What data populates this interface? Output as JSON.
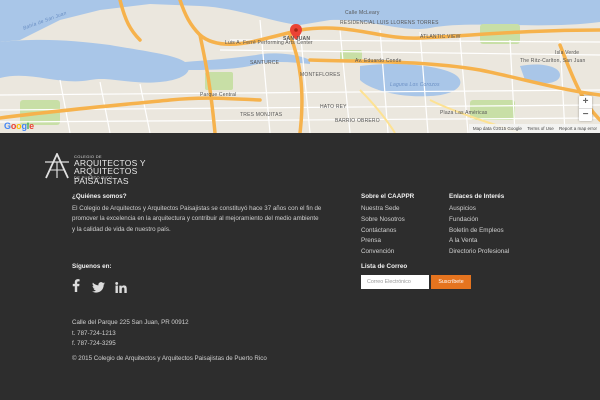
{
  "map": {
    "google_logo": [
      "G",
      "o",
      "o",
      "g",
      "l",
      "e"
    ],
    "google_colors": [
      "#4285f4",
      "#ea4335",
      "#fbbc05",
      "#4285f4",
      "#34a853",
      "#ea4335"
    ],
    "attribution": {
      "data": "Map data ©2015 Google",
      "terms": "Terms of Use",
      "report": "Report a map error"
    },
    "labels": [
      {
        "text": "Bahía de San Juan",
        "type": "water"
      },
      {
        "text": "SAN JUAN",
        "type": "land"
      },
      {
        "text": "RESIDENCIAL LUIS LLORENS TORRES",
        "type": "land"
      },
      {
        "text": "ATLANTIC VIEW",
        "type": "land"
      },
      {
        "text": "Laguna Los Corozos",
        "type": "water"
      },
      {
        "text": "The Ritz-Carlton, San Juan",
        "type": "land"
      },
      {
        "text": "Luis A. Ferré Performing Arts Center",
        "type": "land"
      },
      {
        "text": "Plaza Las Américas",
        "type": "land"
      },
      {
        "text": "Parque Central",
        "type": "land"
      },
      {
        "text": "MONTEFLORES",
        "type": "land"
      },
      {
        "text": "TRES MONJITAS",
        "type": "land"
      },
      {
        "text": "HATO REY",
        "type": "land"
      },
      {
        "text": "SANTURCE",
        "type": "land"
      },
      {
        "text": "BARRIO OBRERO",
        "type": "land"
      },
      {
        "text": "Isla Verde",
        "type": "land"
      },
      {
        "text": "Calle McLeary",
        "type": "land"
      },
      {
        "text": "Av. Eduardo Conde",
        "type": "land"
      }
    ],
    "zoom_in": "+",
    "zoom_out": "−"
  },
  "colors": {
    "footer_bg": "#2d2d2d",
    "accent": "#e5741f",
    "road": "#f6b24c",
    "water": "#a9c6e8",
    "park": "#c8dfa6"
  },
  "footer": {
    "logo": {
      "line1": "COLEGIO DE",
      "line2": "ARQUITECTOS Y",
      "line3": "ARQUITECTOS PAISAJISTAS",
      "line4": "DE PUERTO RICO"
    },
    "about": {
      "heading": "¿Quiénes somos?",
      "text": "El Colegio de Arquitectos y Arquitectos Paisajistas se constituyó hace 37 años con el fin de promover la excelencia en la arquitectura y contribuir al mejoramiento del medio ambiente y la calidad de vida de nuestro país."
    },
    "follow": {
      "heading": "Síguenos en:",
      "icons": [
        "facebook-icon",
        "twitter-icon",
        "linkedin-icon"
      ]
    },
    "sobre": {
      "heading": "Sobre el CAAPPR",
      "links": [
        "Nuestra Sede",
        "Sobre Nosotros",
        "Contáctanos",
        "Prensa",
        "Convención"
      ]
    },
    "enlaces": {
      "heading": "Enlaces de Interés",
      "links": [
        "Auspicios",
        "Fundación",
        "Boletín de Empleos",
        "A la Venta",
        "Directorio Profesional"
      ]
    },
    "newsletter": {
      "heading": "Lista de Correo",
      "placeholder": "Correo Electrónico",
      "button": "Suscríbete"
    },
    "contact": {
      "address": "Calle del Parque 225 San Juan, PR 00912",
      "phone": "t. 787-724-1213",
      "fax": "f. 787-724-3295"
    },
    "copyright": "© 2015 Colegio de Arquitectos y Arquitectos Paisajistas de Puerto Rico"
  }
}
